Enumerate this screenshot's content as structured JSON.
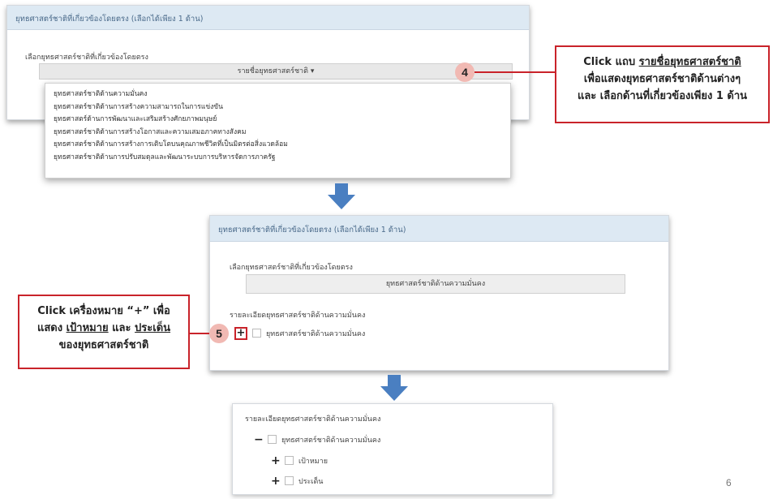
{
  "panel1": {
    "header": "ยุทธศาสตร์ชาติที่เกี่ยวข้องโดยตรง (เลือกได้เพียง 1 ด้าน)",
    "label": "เลือกยุทธศาสตร์ชาติที่เกี่ยวข้องโดยตรง",
    "dropdown_label": "รายชื่อยุทธศาสตร์ชาติ ▾",
    "menu_items": [
      "ยุทธศาสตร์ชาติด้านความมั่นคง",
      "ยุทธศาสตร์ชาติด้านการสร้างความสามารถในการแข่งขัน",
      "ยุทธศาสตร์ด้านการพัฒนาและเสริมสร้างศักยภาพมนุษย์",
      "ยุทธศาสตร์ชาติด้านการสร้างโอกาสและความเสมอภาคทางสังคม",
      "ยุทธศาสตร์ชาติด้านการสร้างการเติบโตบนคุณภาพชีวิตที่เป็นมิตรต่อสิ่งแวดล้อม",
      "ยุทธศาสตร์ชาติด้านการปรับสมดุลและพัฒนาระบบการบริหารจัดการภาครัฐ"
    ]
  },
  "callout4": {
    "number": "4",
    "line1_pre": "Click แถบ ",
    "line1_link": "รายชื่อยุทธศาสตร์ชาติ",
    "line2": "เพื่อแสดงยุทธศาสตร์ชาติด้านต่างๆ",
    "line3": "และ เลือกด้านที่เกี่ยวข้องเพียง 1 ด้าน"
  },
  "panel2": {
    "header": "ยุทธศาสตร์ชาติที่เกี่ยวข้องโดยตรง (เลือกได้เพียง 1 ด้าน)",
    "label": "เลือกยุทธศาสตร์ชาติที่เกี่ยวข้องโดยตรง",
    "selected": "ยุทธศาสตร์ชาติด้านความมั่นคง",
    "detail_label": "รายละเอียดยุทธศาสตร์ชาติด้านความมั่นคง",
    "plus": "+",
    "item": "ยุทธศาสตร์ชาติด้านความมั่นคง"
  },
  "callout5": {
    "number": "5",
    "line1": "Click เครื่องหมาย “+” เพื่อ",
    "line2_pre": "แสดง ",
    "line2_target": "เป้าหมาย",
    "line2_mid": " และ ",
    "line2_issue": "ประเด็น",
    "line3": "ของยุทธศาสตร์ชาติ"
  },
  "panel3": {
    "detail_label": "รายละเอียดยุทธศาสตร์ชาติด้านความมั่นคง",
    "minus": "−",
    "item": "ยุทธศาสตร์ชาติด้านความมั่นคง",
    "children": [
      {
        "sign": "+",
        "label": "เป้าหมาย"
      },
      {
        "sign": "+",
        "label": "ประเด็น"
      }
    ]
  },
  "page_number": "6",
  "colors": {
    "accent_red": "#c9232a",
    "arrow_blue": "#4a7fc1",
    "header_bg": "#dde9f3"
  }
}
